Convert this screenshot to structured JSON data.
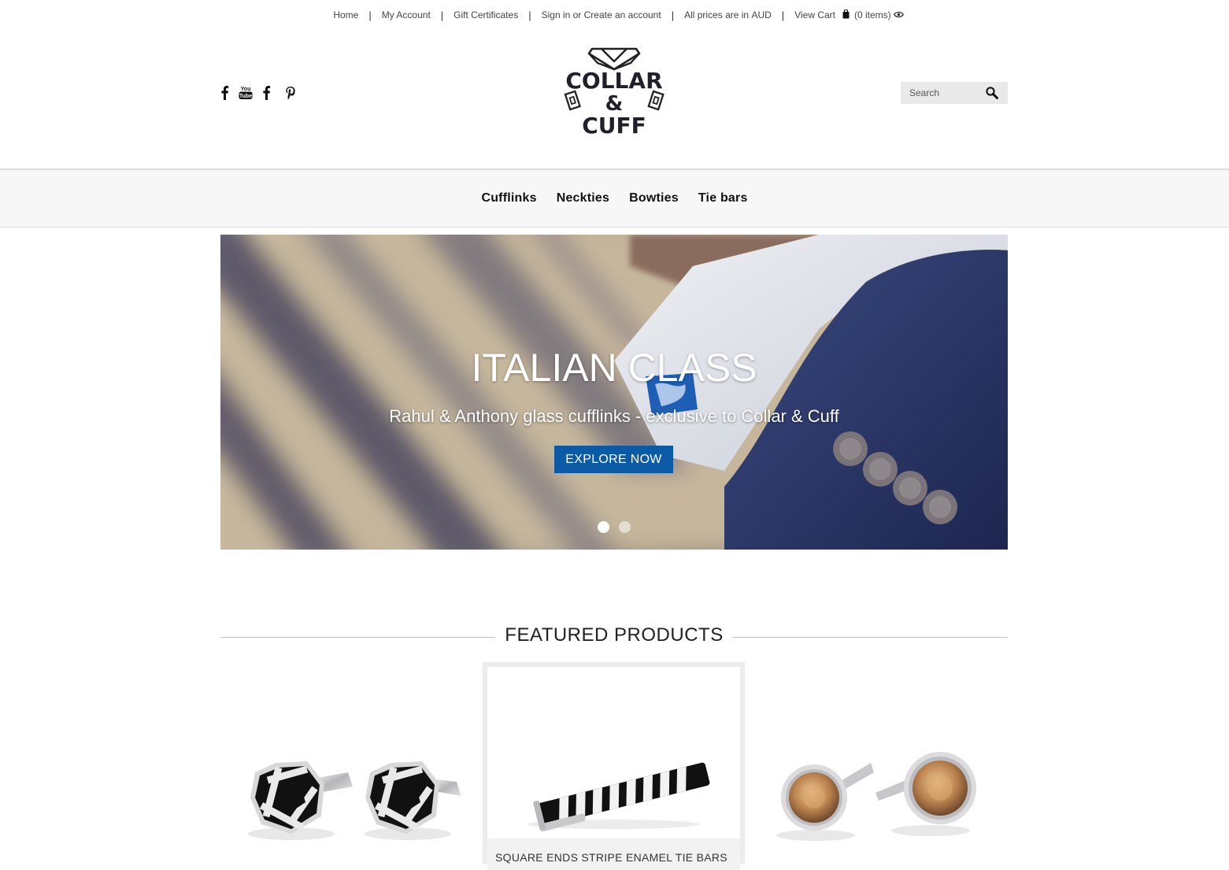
{
  "topbar": {
    "links": [
      "Home",
      "My Account",
      "Gift Certificates",
      "Sign in or Create an account"
    ],
    "prices_prefix": "All prices are in ",
    "currency": "AUD",
    "view_cart": "View Cart",
    "cart_count": "(0 items)"
  },
  "header": {
    "social_icons": [
      "facebook-icon",
      "youtube-icon",
      "facebook-icon",
      "pinterest-icon"
    ],
    "logo_lines": [
      "COLLAR",
      "&",
      "CUFF"
    ],
    "search_placeholder": "Search"
  },
  "nav": {
    "items": [
      "Cufflinks",
      "Neckties",
      "Bowties",
      "Tie bars"
    ]
  },
  "hero": {
    "title": "ITALIAN CLASS",
    "subtitle": "Rahul & Anthony glass cufflinks - exclusive to Collar & Cuff",
    "cta_label": "EXPLORE NOW",
    "slide_count": 2,
    "active_slide": 1
  },
  "featured": {
    "heading": "FEATURED PRODUCTS",
    "products": [
      {
        "name": "",
        "image": "hexagon-black-white-cufflinks"
      },
      {
        "name": "SQUARE ENDS STRIPE ENAMEL TIE BARS",
        "image": "stripe-enamel-tie-bar"
      },
      {
        "name": "",
        "image": "amber-crystal-cufflinks"
      }
    ]
  },
  "colors": {
    "accent": "#0a5aa5",
    "currency_link": "#1a5fb4",
    "nav_bg": "#f7f7f7"
  }
}
